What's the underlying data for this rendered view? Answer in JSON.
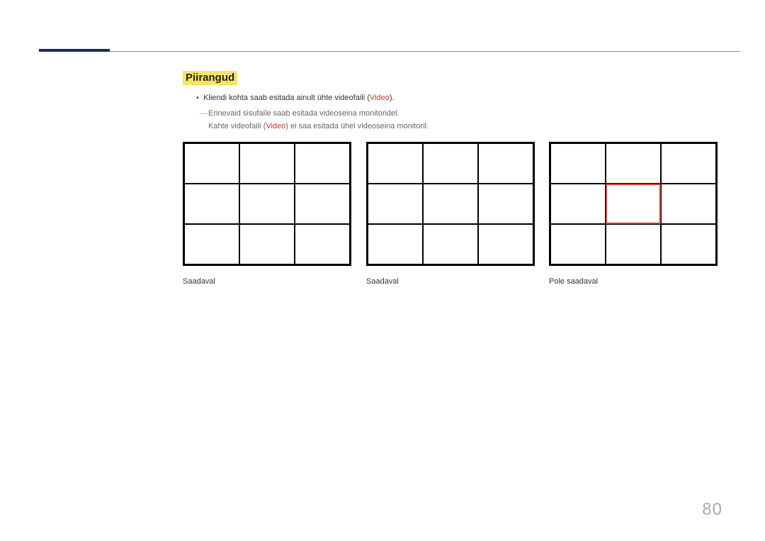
{
  "heading": "Piirangud",
  "bullet_prefix": "Kliendi kohta saab esitada ainult ühte videofaili (",
  "bullet_video": "Video",
  "bullet_suffix": ").",
  "dash_line1": "Erinevaid sisufaile saab esitada videoseina monitoridel.",
  "dash_line2_prefix": "Kahte videofaili (",
  "dash_line2_video": "Video",
  "dash_line2_suffix": ") ei saa esitada ühel videoseina monitoril.",
  "caption1": "Saadaval",
  "caption2": "Saadaval",
  "caption3": "Pole saadaval",
  "page_number": "80"
}
